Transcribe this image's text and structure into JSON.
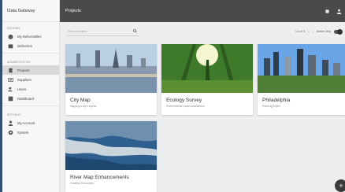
{
  "app": {
    "name": "I2ata Gateway"
  },
  "header": {
    "title": "Projects"
  },
  "sidebar": {
    "sections": [
      {
        "label": "GATEWAY",
        "items": [
          {
            "label": "My Deliverables",
            "icon": "box-icon"
          },
          {
            "label": "Deliveries",
            "icon": "box-icon"
          }
        ]
      },
      {
        "label": "ADMINISTRATION",
        "items": [
          {
            "label": "Projects",
            "icon": "folder-icon"
          },
          {
            "label": "Suppliers",
            "icon": "supplier-icon"
          },
          {
            "label": "Users",
            "icon": "users-icon"
          },
          {
            "label": "Dashboard",
            "icon": "dashboard-icon"
          }
        ]
      },
      {
        "label": "SETTINGS",
        "items": [
          {
            "label": "My Account",
            "icon": "person-icon"
          },
          {
            "label": "System",
            "icon": "gear-icon"
          }
        ]
      }
    ],
    "active": "Projects"
  },
  "filter": {
    "search_placeholder": "Find a project",
    "pager_text": "1-4 of 4",
    "active_only_label": "Active Only"
  },
  "projects": [
    {
      "title": "City Map",
      "subtitle": "Mapping a city's skyline"
    },
    {
      "title": "Ecology Survey",
      "subtitle": "Environmental impact assessment"
    },
    {
      "title": "Philadelphia",
      "subtitle": "Planning project"
    },
    {
      "title": "River Map Enhancements",
      "subtitle": "Coastline Encounters"
    }
  ],
  "colors": {
    "topbar": "#4a4a4a",
    "sidebar_active": "#d9d9d9",
    "edge": "#2f4f73"
  }
}
